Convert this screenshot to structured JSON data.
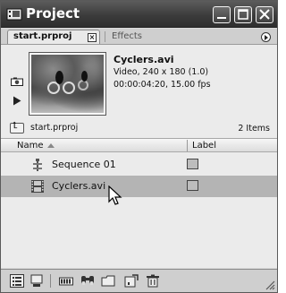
{
  "window": {
    "title": "Project",
    "controls": [
      "minimize-icon",
      "maximize-icon",
      "close-icon"
    ]
  },
  "tabs": {
    "active_label": "start.prproj",
    "close_glyph": "×",
    "inactive_label": "Effects"
  },
  "preview": {
    "clip_name": "Cyclers.avi",
    "info": "Video, 240 x 180 (1.0)",
    "duration": "00:00:04:20, 15.00 fps"
  },
  "bin": {
    "name": "start.prproj",
    "item_count": "2 Items"
  },
  "list": {
    "columns": {
      "name": "Name",
      "label": "Label"
    },
    "items": [
      {
        "name": "Sequence 01",
        "icon": "sequence-icon",
        "selected": false
      },
      {
        "name": "Cyclers.avi",
        "icon": "film-icon",
        "selected": true
      }
    ]
  },
  "colors": {
    "titlebar": "#3c3c3c",
    "selection": "#b4b4b4",
    "panel": "#ebebeb"
  },
  "toolbar": {
    "icons": [
      "list-view-icon",
      "icon-view-icon",
      "automate-to-sequence-icon",
      "find-icon",
      "new-bin-icon",
      "new-item-icon",
      "delete-icon"
    ]
  }
}
